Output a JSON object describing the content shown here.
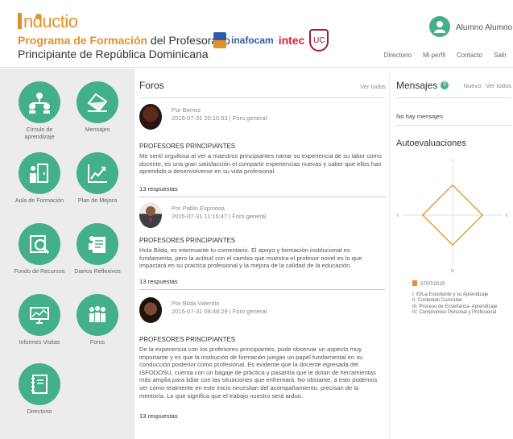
{
  "header": {
    "logo_text": "nductio",
    "program_highlight": "Programa de Formación",
    "program_rest": " del Profesorado",
    "program_line2": "Principiante de República Dominicana",
    "partners": [
      "inafocam",
      "intec",
      "UC"
    ],
    "user_name": "Alumno Alumno",
    "nav": [
      "Directorio",
      "Mi perfil",
      "Contacto",
      "Salir"
    ]
  },
  "sidebar": {
    "tiles": [
      {
        "label": "Círculo de aprendizaje",
        "icon": "learning-circle-icon"
      },
      {
        "label": "Mensajes",
        "icon": "messages-icon"
      },
      {
        "label": "Aula de Formación",
        "icon": "classroom-icon"
      },
      {
        "label": "Plan de Mejora",
        "icon": "improvement-plan-icon"
      },
      {
        "label": "Fondo de Recursos",
        "icon": "resources-icon"
      },
      {
        "label": "Diarios Reflexivos",
        "icon": "reflective-journal-icon"
      },
      {
        "label": "Informes Visitas",
        "icon": "visit-reports-icon"
      },
      {
        "label": "Foros",
        "icon": "forums-icon"
      },
      {
        "label": "Directorio",
        "icon": "directory-icon"
      }
    ]
  },
  "forum": {
    "title": "Foros",
    "see_all": "Ver todos",
    "posts": [
      {
        "author": "Por Berros",
        "meta": "2015-07-31 20:16:53 | Foro general",
        "title": "PROFESORES PRINCIPIANTES",
        "body": "Me sentí orgullosa al ver a maestros principiantes narrar su experiencia de su labor como docente, es una gran satisfacción el compartir experiencias nuevas y saber que ellos han aprendido a desenvolverse en su vida profesional.",
        "replies": "13 respuestas"
      },
      {
        "author": "Por Pablo Espinosa",
        "meta": "2015-07-31 11:15:47 | Foro general",
        "title": "PROFESORES PRINCIPIANTES",
        "body": "Hola Bilda, es interesante tu comentario. El apoyo y formación institucional es fundamenta, pero la actitud con el cambio que muestra el profesor novel es lo que impactará en su practica profesional y la mejora de la calidad de la educación.",
        "replies": "13 respuestas"
      },
      {
        "author": "Por Bilda Valentín",
        "meta": "2015-07-31 08:48:29 | Foro general",
        "title": "PROFESORES PRINCIPIANTES",
        "body": "De la experiencia con los profesores principiantes, pude observar un aspecto muy importante y es que la institución de formación juegan un papel fundamental en su conducción posterior como profesional. Es evidente que la docente egresada del ISFODOSU, cuenta con un bagaje de práctica y pasantía que le dotan de herramientas más amplia para lidiar con las situaciones que enfrentará. No obstante, a esto podemos ver cómo realmente en este inicio necesitan del acompañamiento, precisan de la mentoría. Lo que significa que el trabajo nuestro será arduo.",
        "replies": "13 respuestas"
      }
    ]
  },
  "messages": {
    "title": "Mensajes",
    "badge": "0",
    "new": "Nuevo",
    "see_all": "Ver todos",
    "empty": "No hay mensajes"
  },
  "self_eval": {
    "title": "Autoevaluaciones",
    "axis_labels": [
      "I",
      "II",
      "III",
      "IV"
    ],
    "legend_date": "27/07/2015",
    "legend_items": [
      "I. El/La Estudiante y su Aprendizaje",
      "II. Contenido Curricular",
      "III. Proceso de Enseñanza- Aprendizaje",
      "IV. Compromiso Personal y Profesional"
    ],
    "accent_color": "#e2912a"
  },
  "chart_data": {
    "type": "radar",
    "categories": [
      "I",
      "II",
      "III",
      "IV"
    ],
    "series": [
      {
        "name": "27/07/2015",
        "values": [
          0.6,
          0.6,
          0.6,
          0.6
        ]
      }
    ],
    "range": [
      0,
      1
    ]
  },
  "colors": {
    "brand_green": "#44b08a",
    "brand_orange": "#e2912a",
    "sidebar_bg": "#ececec"
  }
}
